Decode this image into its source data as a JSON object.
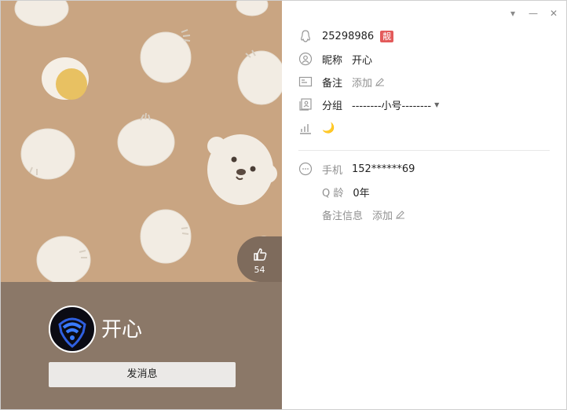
{
  "window": {
    "controls": {
      "dropdown": "▾",
      "minimize": "—",
      "close": "✕"
    }
  },
  "cover": {
    "like_count": "54"
  },
  "profile": {
    "nickname": "开心",
    "send_message_label": "发消息"
  },
  "info": {
    "qq_number": "25298986",
    "qq_badge": "靓",
    "nickname_label": "昵称",
    "nickname_value": "开心",
    "remark_label": "备注",
    "remark_action": "添加",
    "group_label": "分组",
    "group_value": "--------小号--------",
    "level_icon": "🌙",
    "phone_label": "手机",
    "phone_value": "152******69",
    "age_label": "Q 龄",
    "age_value": "0年",
    "remark_info_label": "备注信息",
    "remark_info_action": "添加"
  },
  "colors": {
    "cover_bg": "#c9a582",
    "bottom_bg": "#8b7868",
    "badge_red": "#e35a5a"
  }
}
